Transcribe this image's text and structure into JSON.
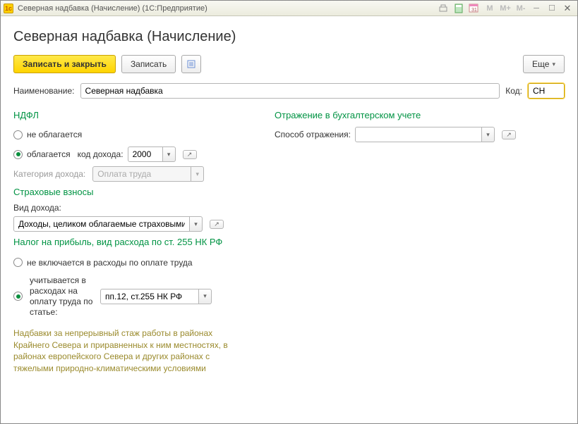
{
  "window": {
    "title": "Северная надбавка (Начисление)  (1С:Предприятие)"
  },
  "header": {
    "form_title": "Северная надбавка (Начисление)"
  },
  "toolbar": {
    "save_close": "Записать и закрыть",
    "save": "Записать",
    "more": "Еще"
  },
  "fields": {
    "name_label": "Наименование:",
    "name_value": "Северная надбавка",
    "code_label": "Код:",
    "code_value": "СН"
  },
  "ndfl": {
    "title": "НДФЛ",
    "not_taxed": "не облагается",
    "taxed": "облагается",
    "income_code_label": "код дохода:",
    "income_code_value": "2000",
    "category_label": "Категория дохода:",
    "category_value": "Оплата труда"
  },
  "insurance": {
    "title": "Страховые взносы",
    "income_type_label": "Вид дохода:",
    "income_type_value": "Доходы, целиком облагаемые страховыми"
  },
  "profit_tax": {
    "title": "Налог на прибыль, вид расхода по ст. 255 НК РФ",
    "not_included": "не включается в расходы по оплате труда",
    "included_label": "учитывается в расходах на оплату труда по статье:",
    "article_value": "пп.12, ст.255 НК РФ"
  },
  "accounting": {
    "title": "Отражение в бухгалтерском учете",
    "method_label": "Способ отражения:",
    "method_value": ""
  },
  "footnote": "Надбавки за непрерывный стаж работы в районах Крайнего Севера и приравненных к ним местностях, в районах европейского Севера и других районах с тяжелыми природно-климатическими условиями"
}
